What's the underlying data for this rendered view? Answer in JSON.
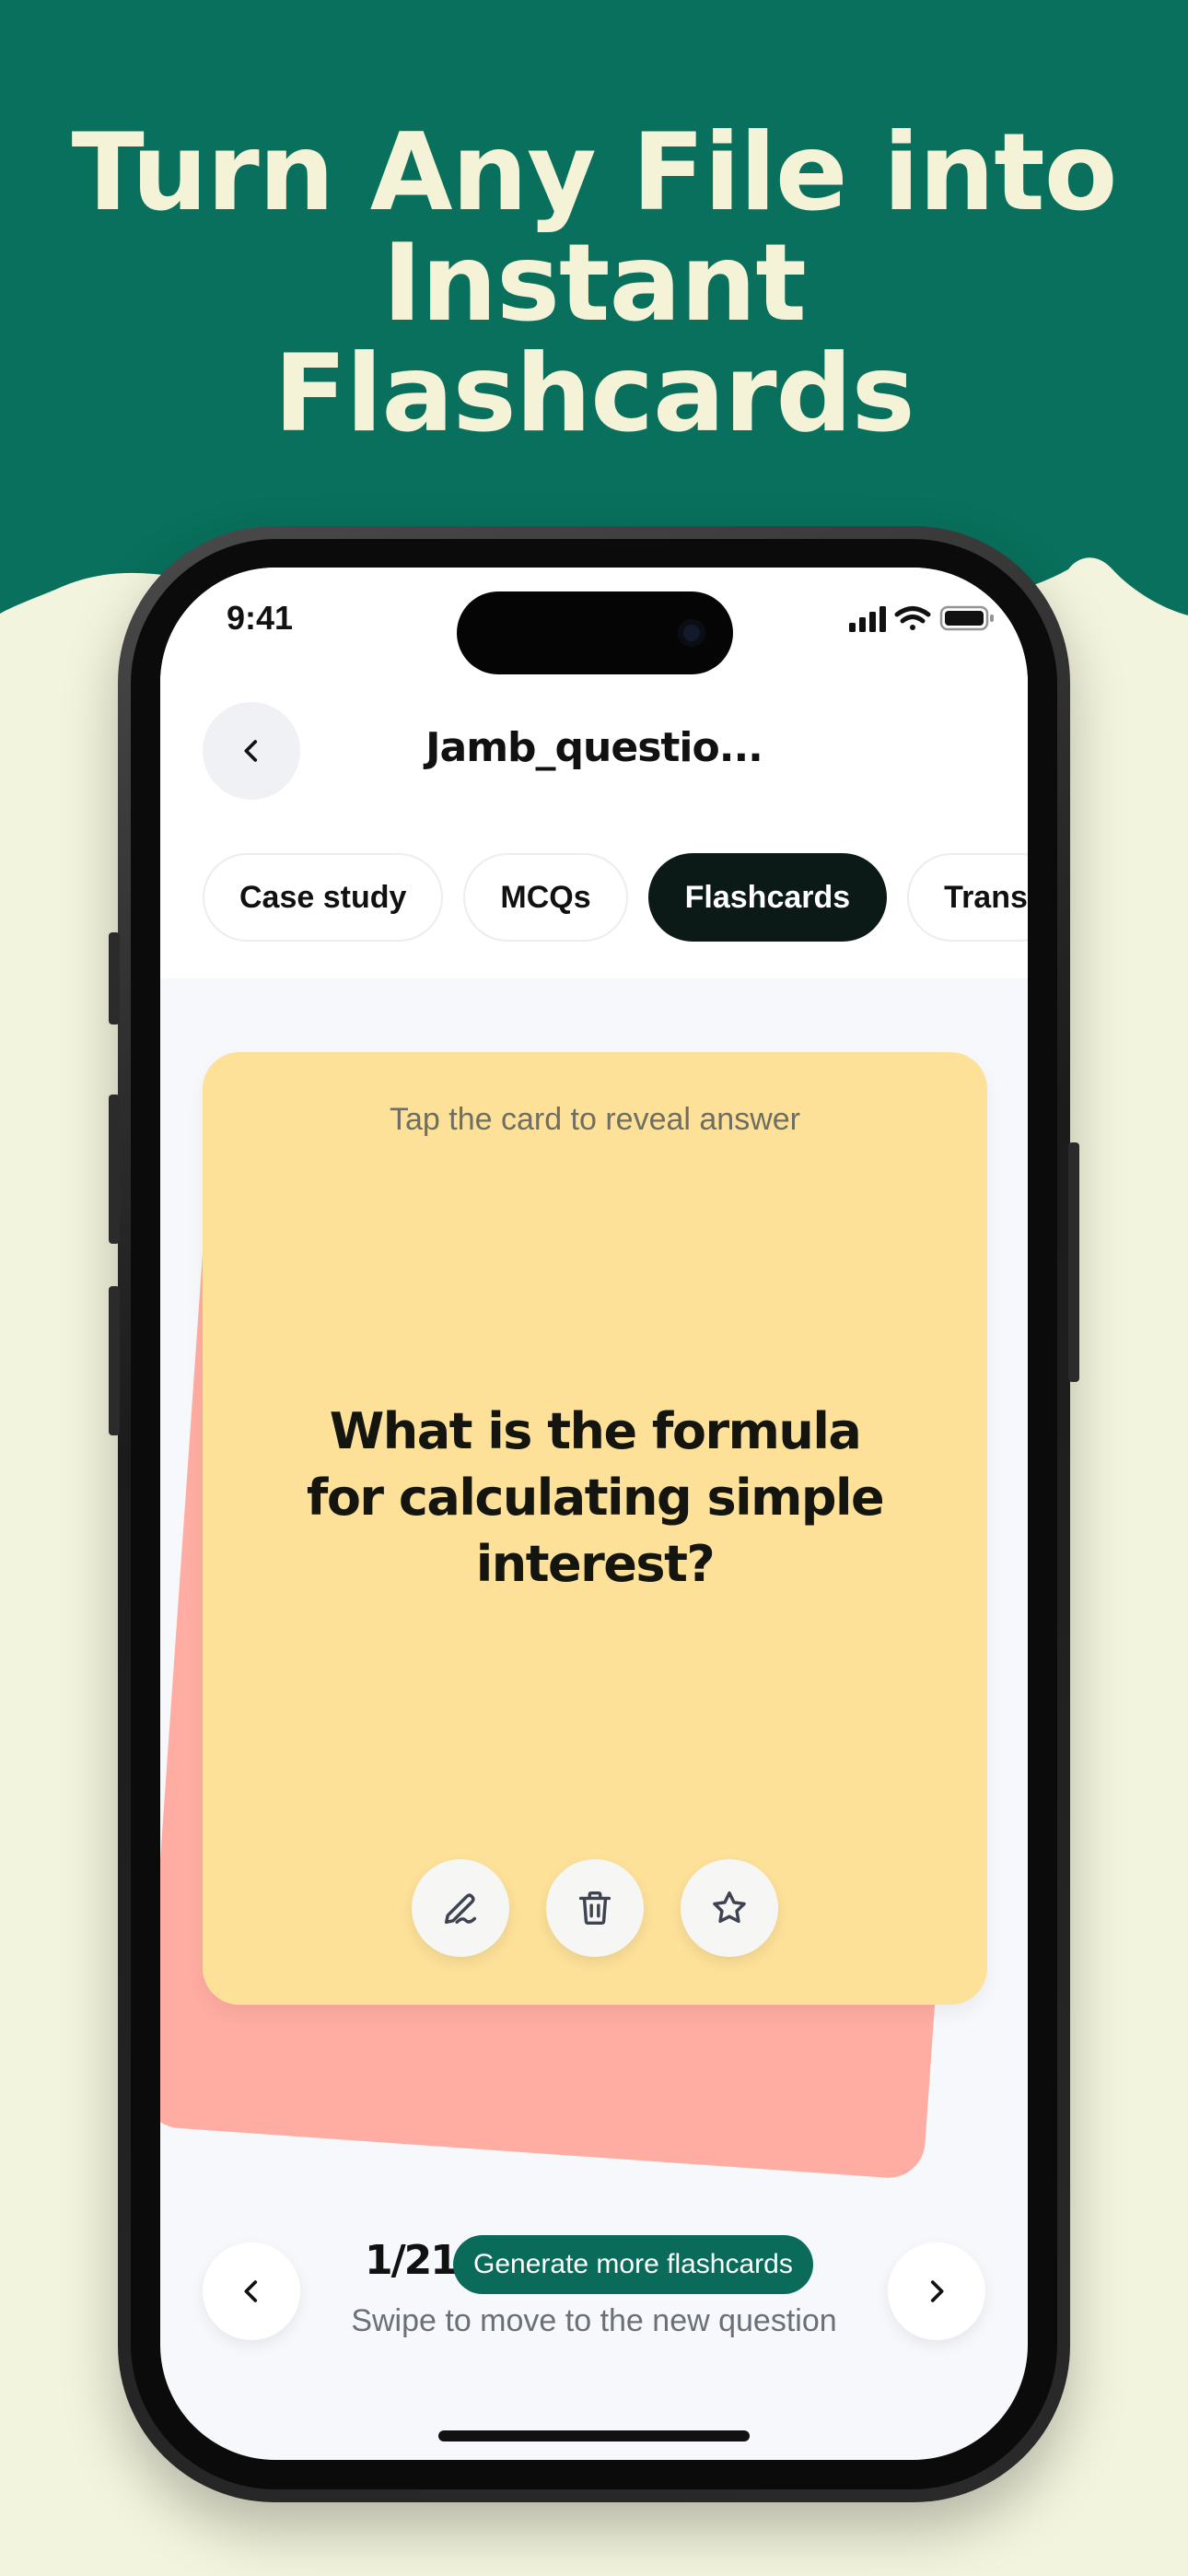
{
  "headline": [
    "Turn Any File into",
    "Instant",
    "Flashcards"
  ],
  "colors": {
    "banner": "#08705C",
    "headline_text": "#F5F3D7",
    "page_bg": "#F3F4DD",
    "card_front": "#FDE199",
    "card_back": "#FFADA2",
    "active_tab": "#0B1A17",
    "generate_button": "#0A6B5B"
  },
  "status_bar": {
    "time": "9:41"
  },
  "header": {
    "title": "Jamb_questio..."
  },
  "tabs": [
    {
      "label": "Case study",
      "active": false
    },
    {
      "label": "MCQs",
      "active": false
    },
    {
      "label": "Flashcards",
      "active": true
    },
    {
      "label": "Trans",
      "active": false
    }
  ],
  "card": {
    "hint": "Tap the card to reveal answer",
    "question": "What is the formula for calculating simple interest?",
    "actions": [
      "edit-icon",
      "trash-icon",
      "star-icon"
    ]
  },
  "footer": {
    "counter": "1/21",
    "generate_label": "Generate more flashcards",
    "swipe_hint": "Swipe to move to the new question"
  }
}
